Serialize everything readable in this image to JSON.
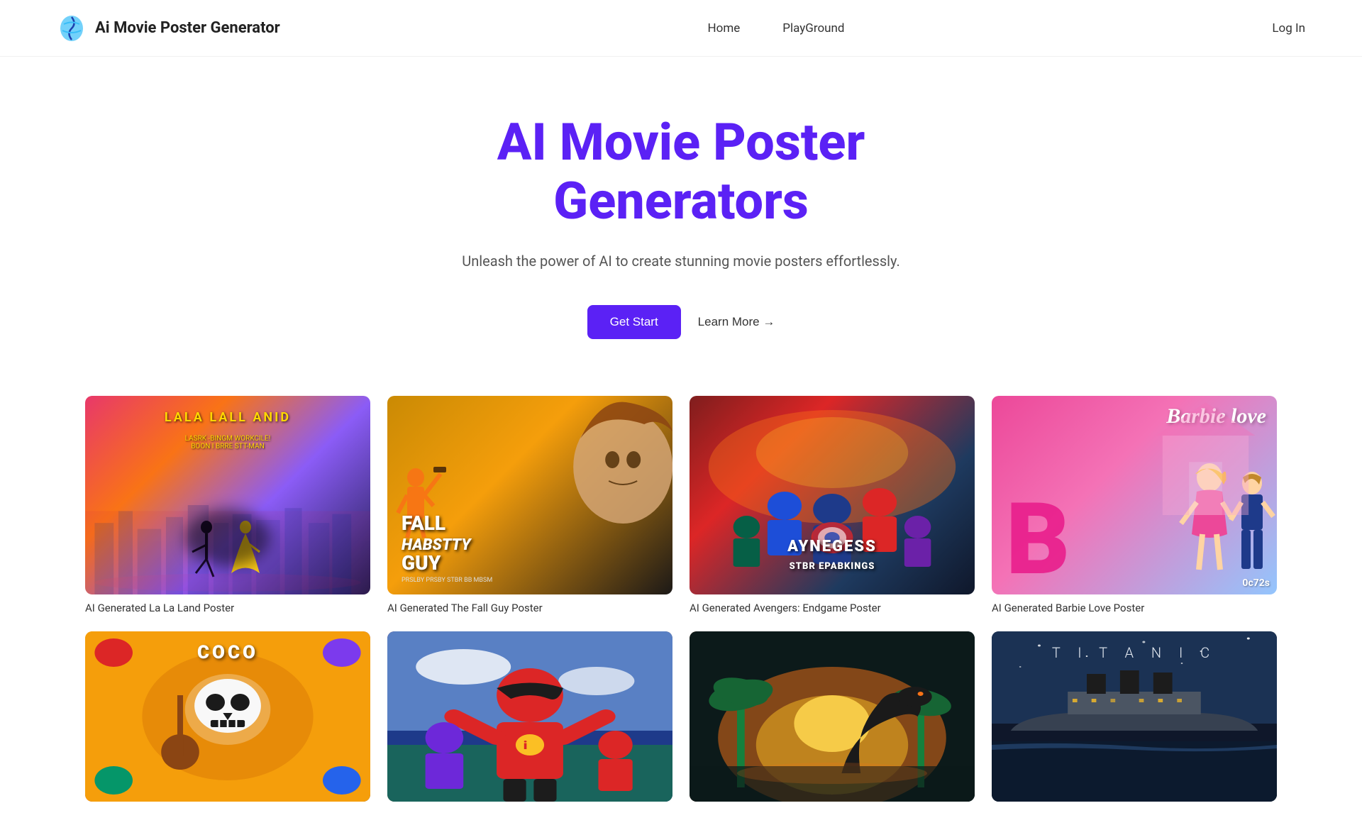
{
  "header": {
    "logo_text": "Ai Movie Poster Generator",
    "nav": {
      "home_label": "Home",
      "playground_label": "PlayGround",
      "login_label": "Log In"
    }
  },
  "hero": {
    "title_line1": "AI Movie Poster",
    "title_line2": "Generators",
    "subtitle": "Unleash the power of AI to create stunning movie posters effortlessly.",
    "get_start_label": "Get Start",
    "learn_more_label": "Learn More →"
  },
  "gallery": {
    "row1": [
      {
        "label": "AI Generated La La Land Poster",
        "top_text": "LALA  LALL ANID",
        "subtitle_text": "LASRK -BINGM WORKCILE!  BOON I BRRE STT-MAN",
        "theme": "lalaland"
      },
      {
        "label": "AI Generated The Fall Guy Poster",
        "main_text": "FALL\nHABSTTY\nGUY",
        "sub_text": "PRSLBY    PRSBY STBR BB MBSM",
        "theme": "fallguy"
      },
      {
        "label": "AI Generated Avengers: Endgame Poster",
        "bottom_text": "AYNEGESS\nSTBR EPABKINGS",
        "theme": "avengers"
      },
      {
        "label": "AI Generated Barbie Love Poster",
        "corner_text": "Barbie love",
        "theme": "barbie"
      }
    ],
    "row2": [
      {
        "label": "",
        "theme": "coco"
      },
      {
        "label": "",
        "theme": "incredibles"
      },
      {
        "label": "",
        "theme": "jurassic"
      },
      {
        "label": "",
        "top_text": "T I T A N I C",
        "theme": "titanic"
      }
    ]
  }
}
